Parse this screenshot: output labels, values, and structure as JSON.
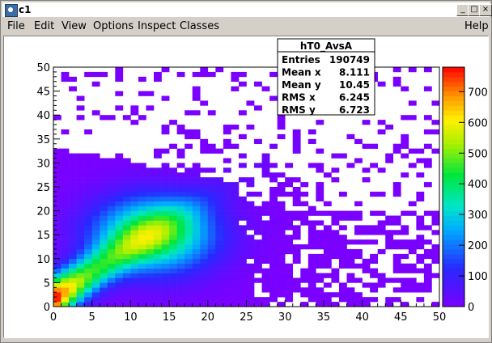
{
  "window": {
    "title": "c1"
  },
  "menu": {
    "file": "File",
    "edit": "Edit",
    "view": "View",
    "options": "Options",
    "inspect": "Inspect",
    "classes": "Classes",
    "help": "Help"
  },
  "stats": {
    "name": "hT0_AvsA",
    "rows": [
      {
        "label": "Entries",
        "value": "190749"
      },
      {
        "label": "Mean x",
        "value": "8.111"
      },
      {
        "label": "Mean y",
        "value": "10.45"
      },
      {
        "label": "RMS x",
        "value": "6.245"
      },
      {
        "label": "RMS y",
        "value": "6.723"
      }
    ]
  },
  "chart_data": {
    "type": "heatmap",
    "x_range": [
      0,
      50
    ],
    "y_range": [
      0,
      50
    ],
    "x_ticks": [
      "0",
      "5",
      "10",
      "15",
      "20",
      "25",
      "30",
      "35",
      "40",
      "45",
      "50"
    ],
    "y_ticks": [
      "0",
      "5",
      "10",
      "15",
      "20",
      "25",
      "30",
      "35",
      "40",
      "45",
      "50"
    ],
    "z_range": [
      0,
      780
    ],
    "z_ticks": [
      "0",
      "100",
      "200",
      "300",
      "400",
      "500",
      "600",
      "700"
    ],
    "bins": 50,
    "stats_position": "top-right"
  }
}
